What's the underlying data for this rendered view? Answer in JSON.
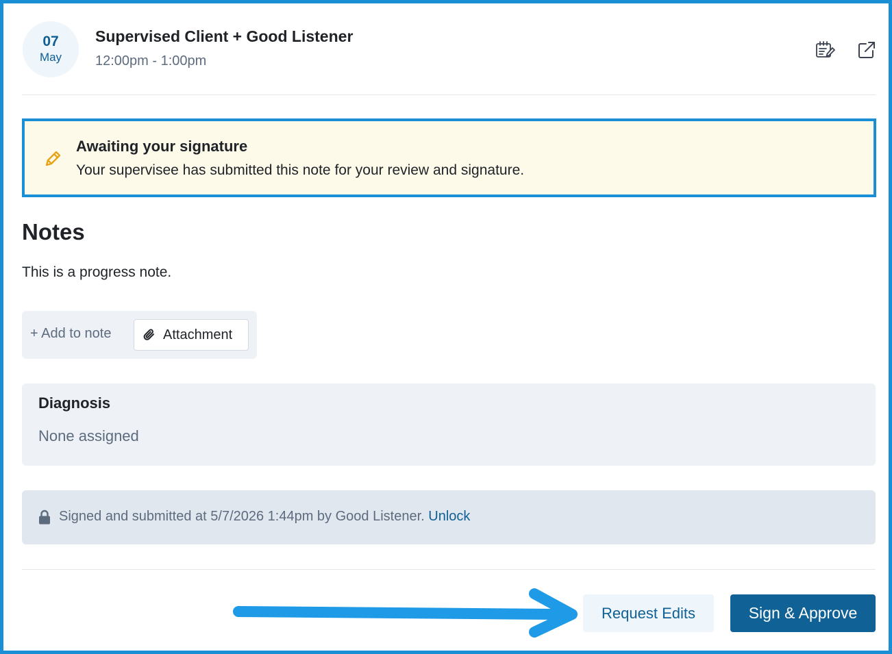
{
  "appointment": {
    "day": "07",
    "month": "May",
    "title": "Supervised Client + Good Listener",
    "time": "12:00pm - 1:00pm"
  },
  "header_icons": {
    "edit": "edit-note-icon",
    "external": "external-link-icon"
  },
  "alert": {
    "icon": "pencil-icon",
    "title": "Awaiting your signature",
    "message": "Your supervisee has submitted this note for your review and signature."
  },
  "notes": {
    "heading": "Notes",
    "body": "This is a progress note.",
    "add_label": "+ Add to note",
    "attachment_label": "Attachment"
  },
  "diagnosis": {
    "title": "Diagnosis",
    "value": "None assigned"
  },
  "signed": {
    "text": "Signed and submitted at 5/7/2026 1:44pm by Good Listener.",
    "unlock_label": "Unlock"
  },
  "actions": {
    "request_edits_label": "Request Edits",
    "sign_approve_label": "Sign & Approve"
  },
  "colors": {
    "accent": "#1a8fd6",
    "primary_button": "#0f6196",
    "alert_background": "#fdfae9",
    "pencil": "#e8a317"
  }
}
